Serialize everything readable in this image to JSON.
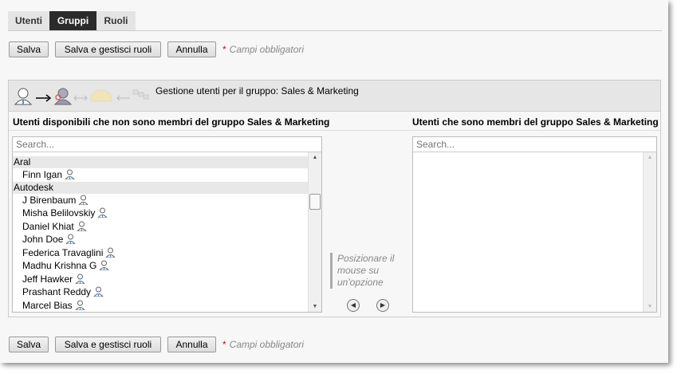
{
  "tabs": [
    {
      "label": "Utenti"
    },
    {
      "label": "Gruppi"
    },
    {
      "label": "Ruoli"
    }
  ],
  "toolbar": {
    "save": "Salva",
    "save_manage": "Salva e gestisci ruoli",
    "cancel": "Annulla",
    "required_mark": "*",
    "required_text": "Campi obbligatori"
  },
  "panel": {
    "title": "Gestione utenti per il gruppo: Sales & Marketing",
    "left_label": "Utenti disponibili che non sono membri del gruppo Sales & Marketing",
    "right_label": "Utenti che sono membri del gruppo Sales & Marketing",
    "search_placeholder": "Search...",
    "groups": [
      {
        "name": "Aral",
        "users": [
          "Finn Igan"
        ]
      },
      {
        "name": "Autodesk",
        "users": [
          "J Birenbaum",
          "Misha Belilovskiy",
          "Daniel Khiat",
          "John Doe",
          "Federica Travaglini",
          "Madhu Krishna G",
          "Jeff Hawker",
          "Prashant Reddy",
          "Marcel Bias"
        ]
      }
    ],
    "hint": "Posizionare il mouse su un'opzione"
  },
  "colors": {
    "active_tab": "#2b2b2b",
    "required": "#dd0000"
  }
}
